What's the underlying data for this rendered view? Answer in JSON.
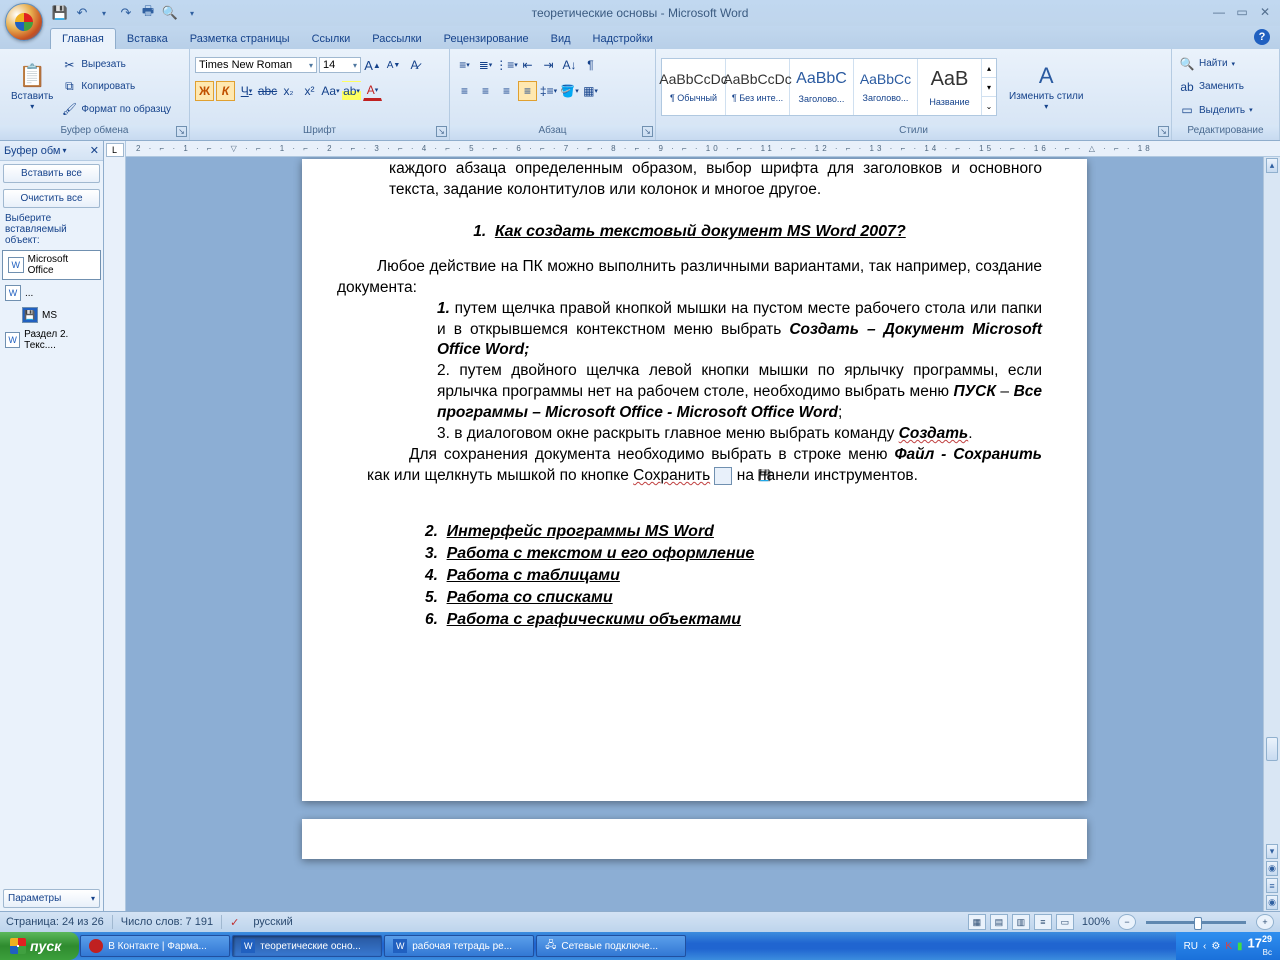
{
  "titlebar": {
    "title": "теоретические основы - Microsoft Word"
  },
  "tabs": {
    "t1": "Главная",
    "t2": "Вставка",
    "t3": "Разметка страницы",
    "t4": "Ссылки",
    "t5": "Рассылки",
    "t6": "Рецензирование",
    "t7": "Вид",
    "t8": "Надстройки"
  },
  "ribbon": {
    "paste": "Вставить",
    "cut": "Вырезать",
    "copy": "Копировать",
    "fmt": "Формат по образцу",
    "g_clip": "Буфер обмена",
    "font_name": "Times New Roman",
    "font_size": "14",
    "g_font": "Шрифт",
    "g_para": "Абзац",
    "styles": {
      "s1p": "AaBbCcDc",
      "s1": "¶ Обычный",
      "s2p": "AaBbCcDc",
      "s2": "¶ Без инте...",
      "s3p": "AaBbC",
      "s3": "Заголово...",
      "s4p": "AaBbCc",
      "s4": "Заголово...",
      "s5p": "AaB",
      "s5": "Название"
    },
    "chg_styles": "Изменить стили",
    "g_styles": "Стили",
    "find": "Найти",
    "replace": "Заменить",
    "select": "Выделить",
    "g_edit": "Редактирование"
  },
  "clip": {
    "title": "Буфер обм",
    "paste_all": "Вставить все",
    "clear_all": "Очистить все",
    "hint": "Выберите вставляемый объект:",
    "item1": "Microsoft Office",
    "item2": "...",
    "item3": "MS",
    "item4": "Раздел 2. Текс....",
    "params": "Параметры"
  },
  "doc": {
    "frag": "каждого абзаца определенным образом, выбор шрифта для заголовков и основного текста, задание колонтитулов или колонок и многое другое.",
    "h1_num": "1.",
    "h1": "Как создать текстовый документ MS Word 2007?",
    "p1": "Любое действие на ПК можно выполнить различными вариантами, так например, создание документа:",
    "li1a": "путем щелчка правой кнопкой мышки на пустом месте рабочего стола или папки и в открывшемся контекстном меню выбрать",
    "li1b": "Создать – Документ Mi­crosoft  Office Word;",
    "li2a": "путем двойного щелчка левой кнопки мышки по ярлычку программы, если ярлычка программы нет на рабочем столе, необходимо выбрать меню ",
    "li2b": "ПУСК",
    "li2c": " – ",
    "li2d": "Все программы – Microsoft  Office - Microsoft  Office Word",
    "li2e": ";",
    "li3a": "в диалоговом окне раскрыть главное меню  выбрать команду",
    "li3b": "Создать",
    "p2a": "Для сохранения документа необходимо выбрать в строке меню ",
    "p2b": "Файл - Сохра­нить",
    "p2c": " как или щелкнуть мышкой по кнопке",
    "p2d": "Сохранить",
    "p2e": " на панели инструментов.",
    "h2n": "2.",
    "h2": "Интерфейс программы MS Word",
    "h3n": "3.",
    "h3": "Работа с текстом и его оформление",
    "h4n": "4.",
    "h4": "Работа с таблицами",
    "h5n": "5.",
    "h5": "Работа со списками",
    "h6n": "6.",
    "h6": "Работа с графическими объектами"
  },
  "ruler": "2 · ⌐ · 1 · ⌐ · ▽ · ⌐ · 1 · ⌐ · 2 · ⌐ · 3 · ⌐ · 4 · ⌐ · 5 · ⌐ · 6 · ⌐ · 7 · ⌐ · 8 · ⌐ · 9 · ⌐ · 10 · ⌐ · 11 · ⌐ · 12 · ⌐ · 13 · ⌐ · 14 · ⌐ · 15 · ⌐ · 16 · ⌐ · △ · ⌐ · 18",
  "status": {
    "page": "Страница: 24 из 26",
    "words": "Число слов: 7 191",
    "lang": "русский",
    "zoom": "100%"
  },
  "taskbar": {
    "start": "пуск",
    "t1": "В Контакте | Фарма...",
    "t2": "теоретические осно...",
    "t3": "рабочая тетрадь ре...",
    "t4": "Сетевые подключе...",
    "lang": "RU",
    "time": "17",
    "time2": "29",
    "day": "Вс"
  }
}
